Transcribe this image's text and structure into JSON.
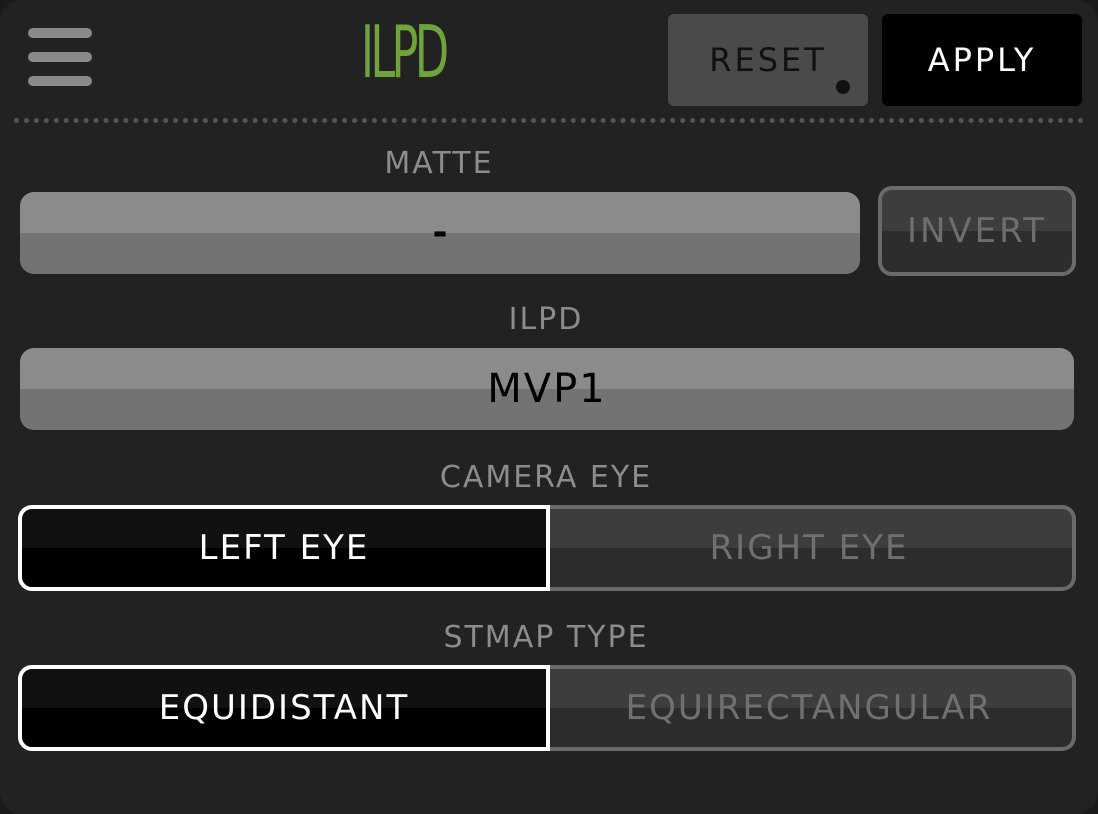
{
  "header": {
    "title": "ILPD",
    "reset_label": "RESET",
    "apply_label": "APPLY"
  },
  "matte": {
    "label": "MATTE",
    "value": "-",
    "invert_label": "INVERT"
  },
  "ilpd": {
    "label": "ILPD",
    "value": "MVP1"
  },
  "camera_eye": {
    "label": "CAMERA EYE",
    "options": [
      "LEFT EYE",
      "RIGHT EYE"
    ],
    "selected": "LEFT EYE"
  },
  "stmap_type": {
    "label": "STMAP TYPE",
    "options": [
      "EQUIDISTANT",
      "EQUIRECTANGULAR"
    ],
    "selected": "EQUIDISTANT"
  },
  "colors": {
    "accent": "#6fa33b",
    "panel_bg": "#222222",
    "field_bg": "#8b8b8b",
    "active_segment": "#000000",
    "label_text": "#8c8c8c"
  },
  "icons": {
    "menu": "hamburger-menu-icon",
    "reset_indicator": "status-dot-icon"
  }
}
